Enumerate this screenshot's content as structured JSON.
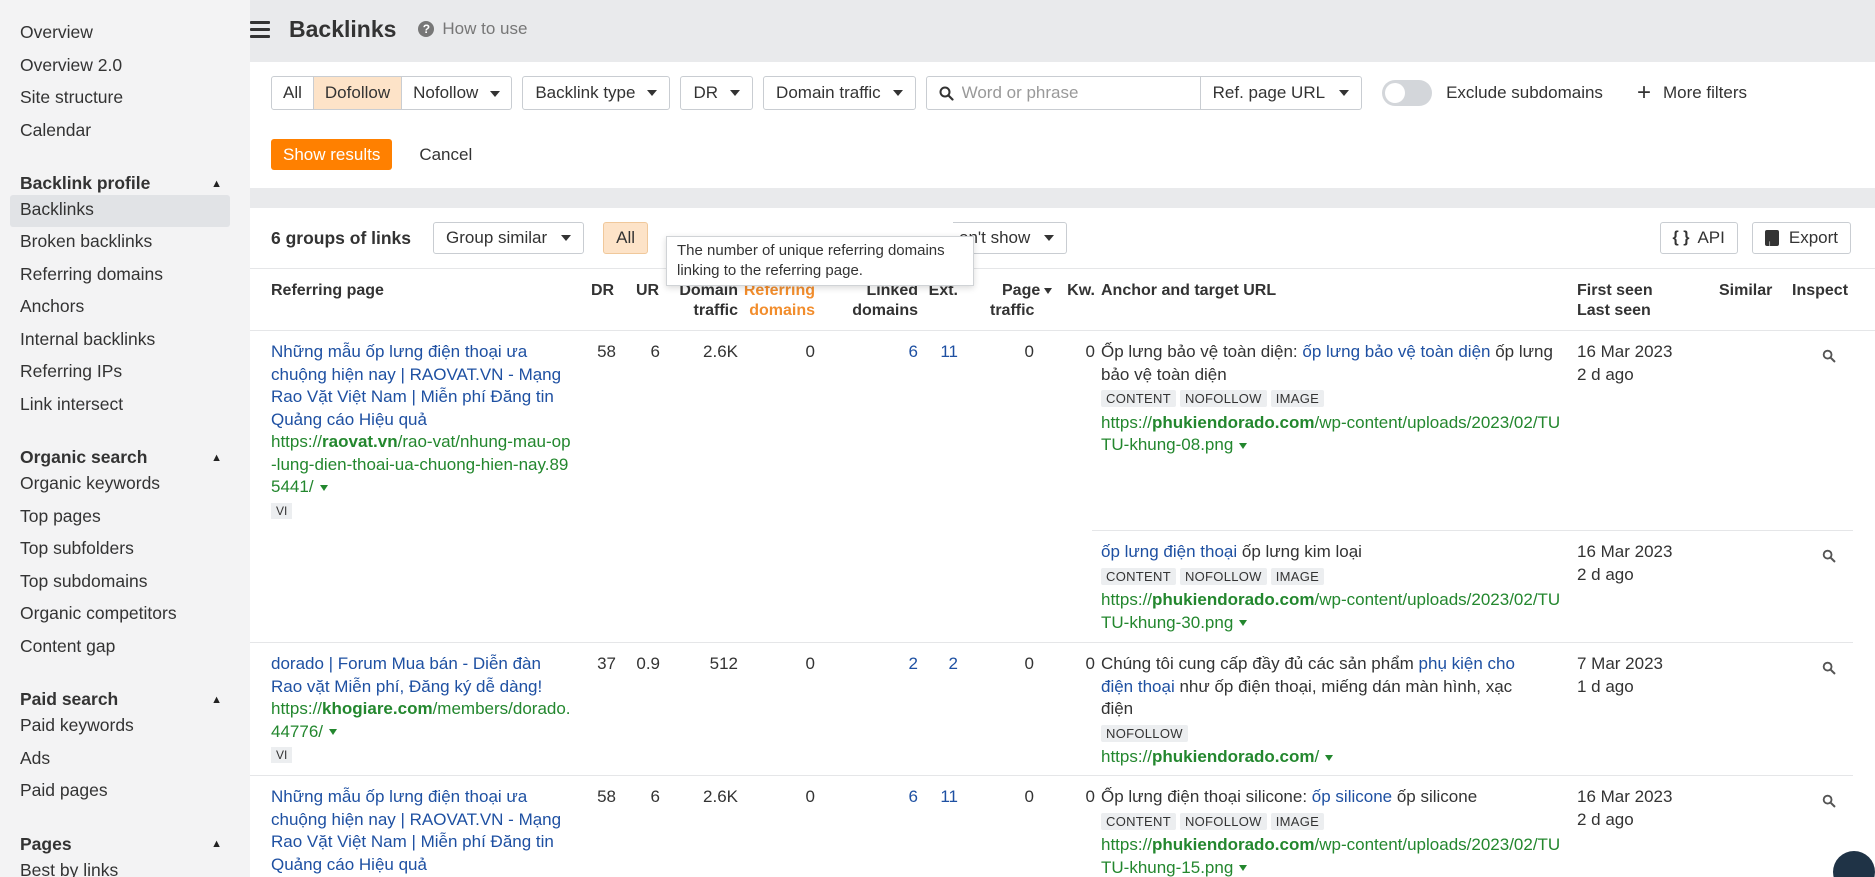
{
  "sidebar": {
    "top_items": [
      "Overview",
      "Overview 2.0",
      "Site structure",
      "Calendar"
    ],
    "sections": [
      {
        "title": "Backlink profile",
        "items": [
          "Backlinks",
          "Broken backlinks",
          "Referring domains",
          "Anchors",
          "Internal backlinks",
          "Referring IPs",
          "Link intersect"
        ]
      },
      {
        "title": "Organic search",
        "items": [
          "Organic keywords",
          "Top pages",
          "Top subfolders",
          "Top subdomains",
          "Organic competitors",
          "Content gap"
        ]
      },
      {
        "title": "Paid search",
        "items": [
          "Paid keywords",
          "Ads",
          "Paid pages"
        ]
      },
      {
        "title": "Pages",
        "items": [
          "Best by links"
        ]
      }
    ],
    "active_item": "Backlinks"
  },
  "header": {
    "title": "Backlinks",
    "how_to_use": "How to use"
  },
  "filters": {
    "seg_all": "All",
    "seg_dofollow": "Dofollow",
    "seg_nofollow": "Nofollow",
    "backlink_type": "Backlink type",
    "dr": "DR",
    "domain_traffic": "Domain traffic",
    "search_placeholder": "Word or phrase",
    "ref_page_url": "Ref. page URL",
    "exclude_subdomains": "Exclude subdomains",
    "more_filters": "More filters",
    "show_results": "Show results",
    "cancel": "Cancel"
  },
  "results": {
    "groups_count": "6 groups of links",
    "group_similar": "Group similar",
    "all": "All",
    "dont_show": "on't show",
    "tooltip": "The number of unique referring domains linking to the referring page.",
    "api": "API",
    "export": "Export"
  },
  "table": {
    "headers": {
      "referring_page": "Referring page",
      "dr": "DR",
      "ur": "UR",
      "domain_traffic_1": "Domain",
      "domain_traffic_2": "traffic",
      "ref_domains_1": "Referring",
      "ref_domains_2": "domains",
      "linked_domains_1": "Linked",
      "linked_domains_2": "domains",
      "ext": "Ext.",
      "page_traffic_1": "Page",
      "page_traffic_2": "traffic",
      "kw": "Kw.",
      "anchor": "Anchor and target URL",
      "first_seen": "First seen",
      "last_seen": "Last seen",
      "similar": "Similar",
      "inspect": "Inspect"
    },
    "rows": [
      {
        "title": "Những mẫu ốp lưng điện thoại ưa chuộng hiện nay | RAOVAT.VN - Mạng Rao Vặt Việt Nam | Miễn phí Đăng tin Quảng cáo Hiệu quả",
        "url_prefix": "https://",
        "url_domain": "raovat.vn",
        "url_path": "/rao-vat/nhung-mau-op-lung-dien-thoai-ua-chuong-hien-nay.895441/",
        "lang": "VI",
        "dr": "58",
        "ur": "6",
        "domain_traffic": "2.6K",
        "ref_domains": "0",
        "linked_domains": "6",
        "ext": "11",
        "page_traffic": "0",
        "kw": "0",
        "anchors": [
          {
            "pre": "Ốp lưng bảo vệ toàn diện: ",
            "link": "ốp lưng bảo vệ toàn diện",
            "post": " ốp lưng bảo vệ toàn diện",
            "tags": [
              "CONTENT",
              "NOFOLLOW",
              "IMAGE"
            ],
            "t_prefix": "https://",
            "t_domain": "phukiendorado.com",
            "t_path": "/wp-content/uploads/2023/02/TUTU-khung-08.png",
            "first_seen": "16 Mar 2023",
            "last_seen": "2 d ago"
          },
          {
            "pre": "",
            "link": "ốp lưng điện thoại",
            "post": " ốp lưng kim loại",
            "tags": [
              "CONTENT",
              "NOFOLLOW",
              "IMAGE"
            ],
            "t_prefix": "https://",
            "t_domain": "phukiendorado.com",
            "t_path": "/wp-content/uploads/2023/02/TUTU-khung-30.png",
            "first_seen": "16 Mar 2023",
            "last_seen": "2 d ago"
          }
        ]
      },
      {
        "title": "dorado | Forum Mua bán - Diễn đàn Rao vặt Miễn phí, Đăng ký dễ dàng!",
        "url_prefix": "https://",
        "url_domain": "khogiare.com",
        "url_path": "/members/dorado.44776/",
        "lang": "VI",
        "dr": "37",
        "ur": "0.9",
        "domain_traffic": "512",
        "ref_domains": "0",
        "linked_domains": "2",
        "ext": "2",
        "page_traffic": "0",
        "kw": "0",
        "anchors": [
          {
            "pre": "Chúng tôi cung cấp đầy đủ các sản phẩm ",
            "link": "phụ kiện cho điện thoại",
            "post": " như ốp điện thoại, miếng dán màn hình, xạc điện",
            "tags": [
              "NOFOLLOW"
            ],
            "t_prefix": "https://",
            "t_domain": "phukiendorado.com",
            "t_path": "/",
            "first_seen": "7 Mar 2023",
            "last_seen": "1 d ago"
          }
        ]
      },
      {
        "title": "Những mẫu ốp lưng điện thoại ưa chuộng hiện nay | RAOVAT.VN - Mạng Rao Vặt Việt Nam | Miễn phí Đăng tin Quảng cáo Hiệu quả",
        "dr": "58",
        "ur": "6",
        "domain_traffic": "2.6K",
        "ref_domains": "0",
        "linked_domains": "6",
        "ext": "11",
        "page_traffic": "0",
        "kw": "0",
        "anchors": [
          {
            "pre": "Ốp lưng điện thoại silicone: ",
            "link": "ốp silicone",
            "post": " ốp silicone",
            "tags": [
              "CONTENT",
              "NOFOLLOW",
              "IMAGE"
            ],
            "t_prefix": "https://",
            "t_domain": "phukiendorado.com",
            "t_path": "/wp-content/uploads/2023/02/TUTU-khung-15.png",
            "first_seen": "16 Mar 2023",
            "last_seen": "2 d ago"
          }
        ]
      }
    ]
  },
  "colors": {
    "accent_orange": "#ff8000",
    "link_blue": "#1e50a2",
    "url_green": "#23872e"
  }
}
